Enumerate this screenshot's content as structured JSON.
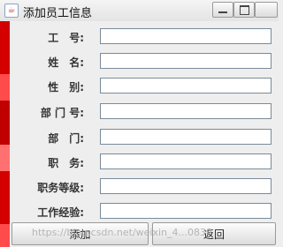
{
  "window": {
    "title": "添加员工信息"
  },
  "form": {
    "fields": [
      {
        "label": "工　号:",
        "value": ""
      },
      {
        "label": "姓　名:",
        "value": ""
      },
      {
        "label": "性　别:",
        "value": ""
      },
      {
        "label": "部 门 号:",
        "value": ""
      },
      {
        "label": "部　门:",
        "value": ""
      },
      {
        "label": "职　务:",
        "value": ""
      },
      {
        "label": "职务等级:",
        "value": ""
      },
      {
        "label": "工作经验:",
        "value": ""
      }
    ]
  },
  "buttons": {
    "add": "添加",
    "back": "返回"
  },
  "watermark": "https://blog.csdn.net/weixin_4...0839"
}
